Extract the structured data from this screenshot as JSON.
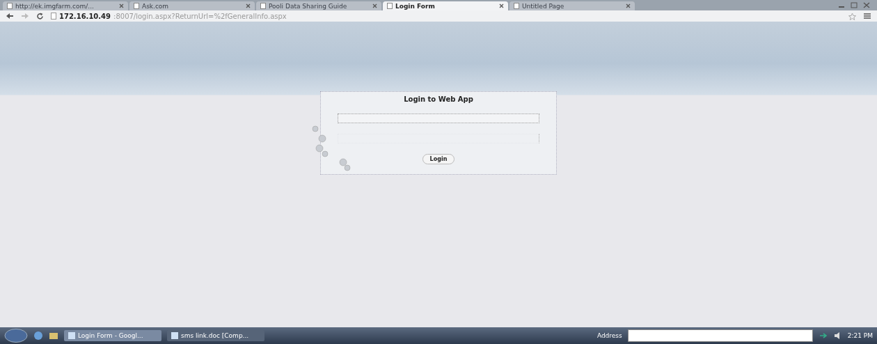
{
  "tabs": [
    {
      "label": "http://ek.imgfarm.com/...",
      "selected": false
    },
    {
      "label": "Ask.com",
      "selected": false
    },
    {
      "label": "Pooli Data Sharing Guide",
      "selected": false
    },
    {
      "label": "Login Form",
      "selected": true
    },
    {
      "label": "Untitled Page",
      "selected": false
    }
  ],
  "address": {
    "host": "172.16.10.49",
    "rest": ":8007/login.aspx?ReturnUrl=%2fGeneralInfo.aspx"
  },
  "dialog": {
    "title": "Login to Web App",
    "fields": [
      {
        "kind": "text"
      },
      {
        "kind": "password"
      }
    ],
    "button": "Login"
  },
  "taskbar": {
    "items": [
      {
        "label": "Login Form - Googl...",
        "selected": true
      },
      {
        "label": "sms link.doc [Comp...",
        "selected": false
      }
    ],
    "address_label": "Address",
    "time": "2:21 PM"
  }
}
